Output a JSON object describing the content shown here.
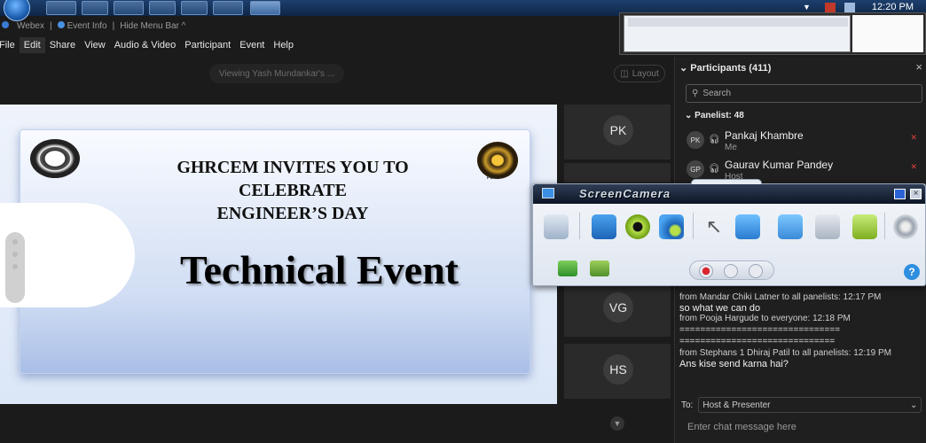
{
  "taskbar": {
    "time": "12:20 PM"
  },
  "title_bar": {
    "app": "Webex",
    "event_info": "Event Info",
    "hide_menu": "Hide Menu Bar"
  },
  "menu": {
    "items": [
      "File",
      "Edit",
      "Share",
      "View",
      "Audio & Video",
      "Participant",
      "Event",
      "Help"
    ]
  },
  "share": {
    "viewing_label": "Viewing Yash Mundankar's ...",
    "layout_label": "Layout"
  },
  "slide": {
    "heading_line1": "GHRCEM INVITES YOU TO",
    "heading_line2": "CELEBRATE",
    "heading_line3": "ENGINEER’S DAY",
    "big_text": "Technical Event",
    "right_logo_caption": "PUNE"
  },
  "video_tiles": [
    {
      "initials": "PK"
    },
    {
      "initials": "VG"
    },
    {
      "initials": "HS"
    }
  ],
  "participants": {
    "header": "Participants (411)",
    "search_placeholder": "Search",
    "group_label": "Panelist: 48",
    "people": [
      {
        "initials": "PK",
        "name": "Pankaj Khambre",
        "sub": "Me"
      },
      {
        "initials": "GP",
        "name": "Gaurav Kumar Pandey",
        "sub": "Host"
      }
    ]
  },
  "chat": {
    "lines": [
      {
        "kind": "meta",
        "text": "from Mandar Chiki Latner to all panelists:   12:17 PM"
      },
      {
        "kind": "msg",
        "text": "so what we can do"
      },
      {
        "kind": "meta",
        "text": "from Pooja Hargude to everyone:   12:18 PM"
      },
      {
        "kind": "sep",
        "text": "==============================="
      },
      {
        "kind": "sep",
        "text": "=============================="
      },
      {
        "kind": "meta",
        "text": "from Stephans 1 Dhiraj Patil to all panelists:   12:19 PM"
      },
      {
        "kind": "msg",
        "text": "Ans kise send karna hai?"
      }
    ],
    "to_label": "To:",
    "to_value": "Host & Presenter",
    "input_placeholder": "Enter chat message here"
  },
  "screencamera": {
    "title": "ScreenCamera"
  }
}
